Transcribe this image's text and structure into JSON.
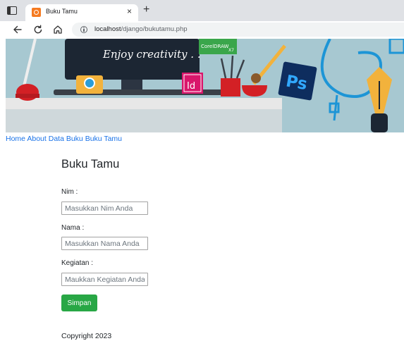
{
  "browser": {
    "tab_title": "Buku Tamu",
    "tab_close": "×",
    "new_tab": "+",
    "url_host": "localhost",
    "url_path": "/django/bukutamu.php"
  },
  "banner": {
    "tagline": "Enjoy creativity . .",
    "coreldraw_label": "CorelDRAW",
    "coreldraw_version": "X7",
    "indesign_label": "Id",
    "photoshop_label": "Ps",
    "colors": {
      "background": "#a7c8d1",
      "monitor": "#1c2633",
      "photoshop": "#0e2d5e",
      "indesign": "#d9166b",
      "coreldraw": "#3aa64b",
      "lamp": "#d32025",
      "pen": "#f2b23c",
      "camera": "#f2b23c"
    }
  },
  "nav": {
    "items": [
      "Home",
      "About",
      "Data Buku",
      "Buku Tamu"
    ]
  },
  "form": {
    "title": "Buku Tamu",
    "nim_label": "Nim :",
    "nim_placeholder": "Masukkan Nim Anda",
    "nama_label": "Nama :",
    "nama_placeholder": "Masukkan Nama Anda",
    "kegiatan_label": "Kegiatan :",
    "kegiatan_placeholder": "Maukkan Kegiatan Anda",
    "submit_label": "Simpan",
    "submit_color": "#28a745"
  },
  "footer": {
    "text": "Copyright 2023"
  },
  "accent": {
    "link_color": "#1a73e8"
  }
}
